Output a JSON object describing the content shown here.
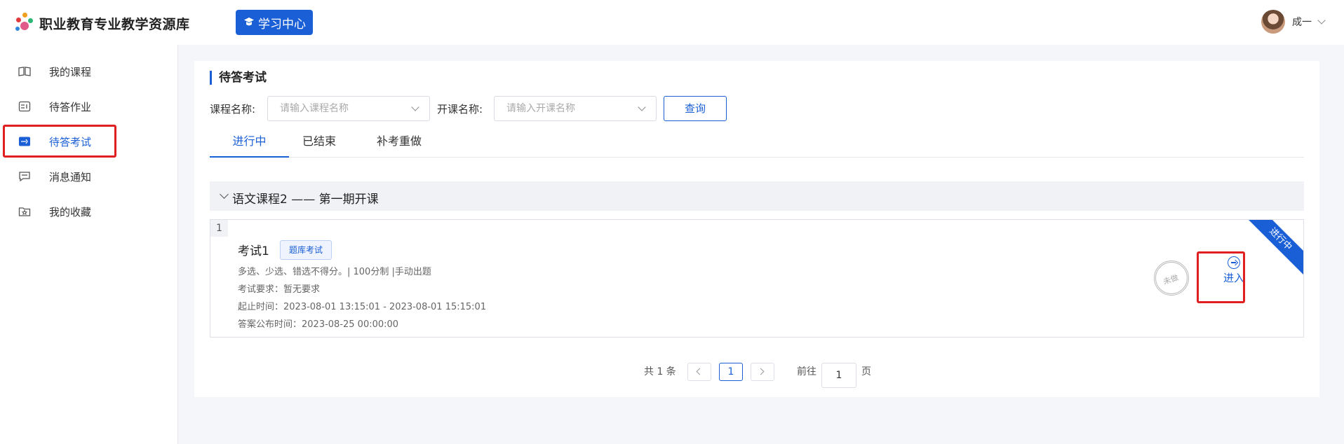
{
  "app": {
    "title": "职业教育专业教学资源库",
    "learn_center": "学习中心",
    "user_name": "成一"
  },
  "sidebar": {
    "items": [
      {
        "label": "我的课程",
        "icon": "book-icon"
      },
      {
        "label": "待答作业",
        "icon": "homework-icon"
      },
      {
        "label": "待答考试",
        "icon": "exam-icon"
      },
      {
        "label": "消息通知",
        "icon": "message-icon"
      },
      {
        "label": "我的收藏",
        "icon": "favorite-icon"
      }
    ],
    "active": "待答考试"
  },
  "main": {
    "title": "待答考试",
    "filters": {
      "course_label": "课程名称:",
      "course_placeholder": "请输入课程名称",
      "class_label": "开课名称:",
      "class_placeholder": "请输入开课名称",
      "query_label": "查询"
    },
    "tabs": [
      {
        "label": "进行中",
        "active": true
      },
      {
        "label": "已结束",
        "active": false
      },
      {
        "label": "补考重做",
        "active": false
      }
    ],
    "group": {
      "title": "语文课程2 —— 第一期开课"
    },
    "exam": {
      "index": "1",
      "name": "考试1",
      "tag": "题库考试",
      "rules": "多选、少选、错选不得分。| 100分制 |手动出题",
      "requirement": "考试要求：暂无要求",
      "time": "起止时间：2023-08-01 13:15:01 - 2023-08-01 15:15:01",
      "publish": "答案公布时间：2023-08-25 00:00:00",
      "stamp": "未做",
      "enter_label": "进入",
      "ribbon": "进行中"
    },
    "pagination": {
      "total": "共 1 条",
      "current": "1",
      "goto": "前往",
      "page_value": "1",
      "page_unit": "页"
    }
  },
  "colors": {
    "accent": "#1a5fd6",
    "highlight": "#e02020"
  }
}
